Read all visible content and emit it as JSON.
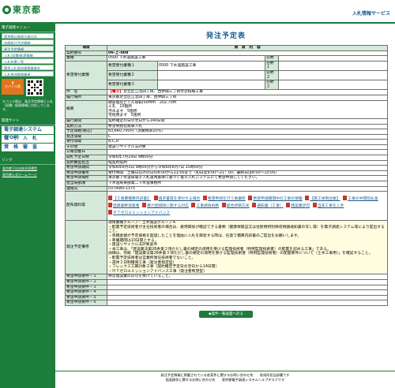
{
  "header": {
    "logo": "東京都",
    "service": "入札情報サービス"
  },
  "side": {
    "head1": "電子調達メニュー",
    "items": [
      "東京都公報発注者公告",
      "年間発注予定情報",
      "発注予定情報",
      "入札(見積)経過情報",
      "入札結果一覧",
      "競争入札参加資格業者名",
      "入札参加資格業者"
    ],
    "mobile_label": "モバイル版",
    "mobile_note": "モバイル版は、発注予定情報と入札（見積）経過情報に対応しています。",
    "head2": "関連サイト",
    "big": [
      "電子調達システム(TOP)",
      "電　子　入　札",
      "資　格　審　査"
    ],
    "head3": "リンク",
    "links": [
      "東京都下自治体共同運営",
      "東京都公式ホームページ"
    ]
  },
  "main": {
    "title": "発注予定表",
    "col_item": "項目",
    "col_content": "項　目　内　容",
    "rows": {
      "contract_no": [
        "契約番号",
        "06-上-008"
      ],
      "gyoshu": "業種",
      "gyoshu_v": [
        "0500 下水道施設工事"
      ],
      "bunya": [
        "分野",
        "分野１",
        "分野２",
        "分野３"
      ],
      "kibo": "希望受付業種",
      "kibo_v": [
        [
          "希望受付業種１",
          "0500 下水道施設工事"
        ],
        [
          "希望受付業種２",
          ""
        ],
        [
          "希望受付業種３",
          ""
        ]
      ],
      "kenmei": "件　名",
      "kenmei_tag": "【電子】",
      "kenmei_v": "足立区江北四丁目、西伊興三丁目付近枝線工事",
      "place": [
        "履行場所",
        "東京都足立区江北四丁目、西伊興三丁目"
      ],
      "summary": "概要",
      "summary_v": [
        "硬質塩化ビニル管φ250mm　202.70m",
        "人孔　10箇所",
        "汚水ます　5箇所",
        "宅地用ます　5箇所"
      ],
      "period": [
        "履行期間",
        "契約確定の日の翌日から140日間"
      ],
      "method": [
        "契約方法",
        "希望制指名競争入札"
      ],
      "price": [
        "予定価格(税込)",
        "83,640,700円（消費税率10％）"
      ],
      "grade": [
        "発注等級",
        "C"
      ],
      "rank": [
        "受付等級",
        "B,C,D"
      ],
      "other": [
        "その他",
        "建設リサイクル法対象"
      ],
      "ann": [
        "公報登載日",
        ""
      ],
      "open": [
        "開札予定日時",
        "令和6年7月19日 9時00分"
      ],
      "range": [
        "契約審査担当",
        "経契約契約"
      ],
      "req": [
        "希望申請期間",
        "令和6年6月3日 9時00分から令和6年6月7日 15時00分"
      ],
      "remark": [
        "希望申請備考",
        "受付時間　土曜日以外の日の8:00から21:00まで（初日は9:00～21：00、最終日は8:00～15:00）"
      ],
      "where": [
        "希望申請場所",
        "東京都下水道局電子入札運用基準に基づく電子入札システムにて希望申請してください。"
      ],
      "dept": [
        "担当局部課",
        "下水道局東部第二下水道事務所"
      ],
      "tel": [
        "連絡先",
        "03-5680-1375"
      ],
      "docs": "配布資料等",
      "attachments": [
        "【工事費積算内訳書】",
        "請求書等を添付する場合",
        "希望申請を行う事業所",
        "希望申請期間中の工事の情報",
        "【施工体制台帳】",
        "工事の中間前払金",
        "登録基幹技能者",
        "暴力団排除に関する対応",
        "工事請負約款",
        "総合評価方式",
        "通知書（工事）",
        "建設業許可",
        "当該工事を入手",
        "ＨＴゼロエミッションアドバンス"
      ],
      "notes_label": "発注予定備考",
      "notes": [
        "適用業種グループ：土木施設グループＡ",
        "・配置予定技術者が主任技術者の場合は、雇用関係が確認できる書類（健康保険証又は住民税特別徴収税額通知書の写し等）を電子調達システム等により提出すること。",
        "・見積金額が予定価格を超過したことを理由に入札を辞退する際は、任意で積算内訳書のご提出をお願いします。",
        "・準備期間は10日間とする。",
        "・建設リサイクル法対象案件",
        "・本工事は、「建設業法第26条第３項ただし書の規定の適用を受ける監理技術者（特例監理技術者）の配置を認める工事」である。",
        "詳細は、別紙「建設業法第26条第３項ただし書の規定の適用を受ける監理技術者（特例監理技術者）の配置要件について（土木工事用）」を確認すること。",
        "・配置予定技術者は営業所専任技術者でないこと。",
        "・週休２日制確保工事（発注者指定型）",
        "・フレックス工期対象工事（契約確定予定日の翌日から14日間）",
        "・ＨＴゼロエミッションアドバンス工事（発注者希望型）"
      ],
      "changes": [
        "希望申請要件－１",
        "特定建設業の許可を受けていること。"
      ],
      "changes_rest": [
        "希望申請要件－２",
        "希望申請要件－３",
        "希望申請要件－４",
        "希望申請要件－５",
        "希望申請要件－６"
      ]
    },
    "back": "◆案件一覧画面へ戻る"
  },
  "footer": {
    "line1": "発注予定情報に掲載されている各案件に関するお問い合わせ先　　各局所担当部署です",
    "line2": "画面操作に関するお問い合わせ先　　東京都電子調達システムヘルプデスクです"
  },
  "colors": {
    "green": "#1d7d3b",
    "head": "#d5e9d9",
    "blue": "#1d5c8e"
  }
}
